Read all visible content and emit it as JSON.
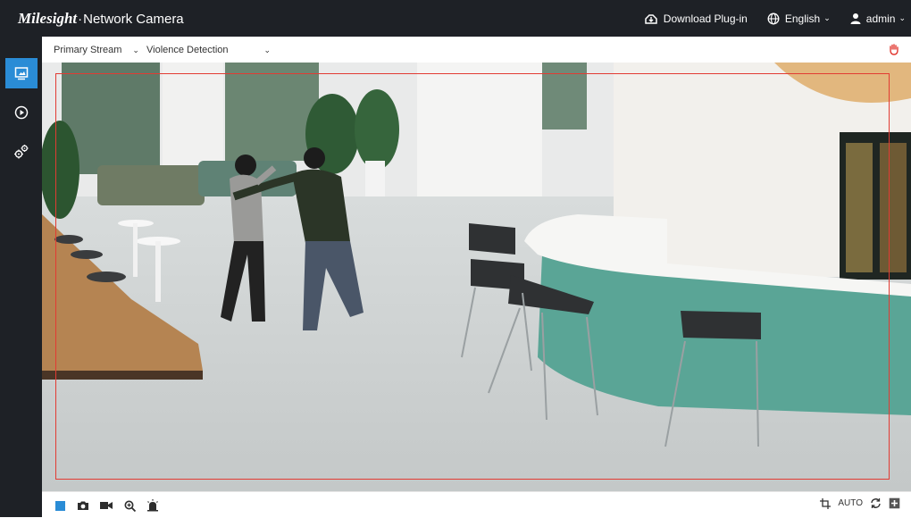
{
  "header": {
    "brand": "Milesight",
    "title": "Network Camera",
    "download_label": "Download Plug-in",
    "language": "English",
    "user": "admin"
  },
  "sidebar": {
    "items": [
      {
        "icon": "live-view-icon",
        "active": true
      },
      {
        "icon": "playback-icon",
        "active": false
      },
      {
        "icon": "settings-gears-icon",
        "active": false
      }
    ]
  },
  "stream": {
    "stream_type": "Primary Stream",
    "detection_mode": "Violence Detection"
  },
  "toolbar": {
    "left_icons": [
      "stop-icon",
      "snapshot-icon",
      "record-icon",
      "zoom-icon",
      "alarm-icon"
    ],
    "zoom_mode": "AUTO"
  },
  "colors": {
    "topbar": "#1e2126",
    "accent": "#2a8cd6",
    "roi_border": "#e23b33"
  }
}
